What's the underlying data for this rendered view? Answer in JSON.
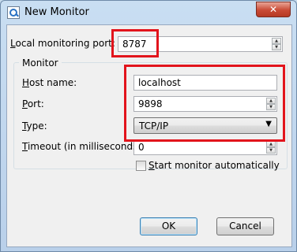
{
  "window": {
    "title": "New Monitor",
    "close_glyph": "✕"
  },
  "local_port": {
    "label": "Local monitoring port:",
    "mnemonic": "L",
    "rest": "ocal monitoring port:",
    "value": "8787"
  },
  "monitor_group": {
    "title": "Monitor"
  },
  "host": {
    "mnemonic": "H",
    "rest": "ost name:",
    "value": "localhost"
  },
  "port": {
    "mnemonic": "P",
    "rest": "ort:",
    "value": "9898"
  },
  "type": {
    "mnemonic": "T",
    "rest": "ype:",
    "value": "TCP/IP"
  },
  "timeout": {
    "mnemonic": "T",
    "rest": "imeout (in milliseconds):",
    "value": "0"
  },
  "start_auto": {
    "mnemonic": "S",
    "rest": "tart monitor automatically",
    "checked": false
  },
  "buttons": {
    "ok": "OK",
    "cancel": "Cancel"
  },
  "annotation_color": "#e2141c",
  "icons": [
    "monitor-app-icon",
    "close-icon",
    "spin-up-icon",
    "spin-down-icon",
    "dropdown-arrow-icon"
  ]
}
